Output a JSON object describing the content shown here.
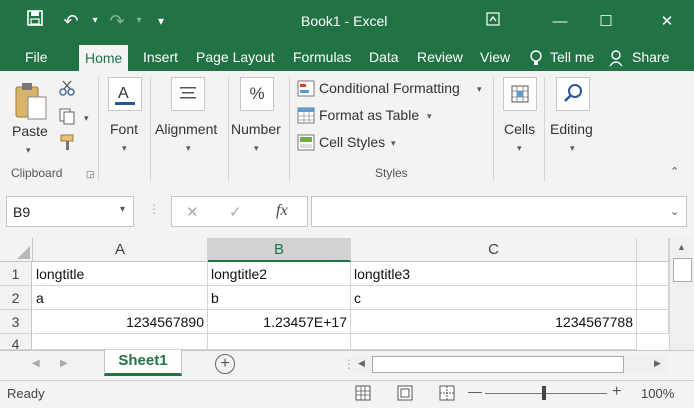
{
  "window": {
    "title": "Book1  -  Excel",
    "minimize": "—",
    "maximize": "☐",
    "close": "✕",
    "ribbon_display": "⬆"
  },
  "qat": {
    "save": "💾",
    "undo": "↶",
    "redo": "↷",
    "customize": "▾"
  },
  "tabs": [
    "File",
    "Home",
    "Insert",
    "Page Layout",
    "Formulas",
    "Data",
    "Review",
    "View"
  ],
  "tell_me": "Tell me",
  "share": "Share",
  "ribbon": {
    "clipboard": {
      "paste": "Paste",
      "group": "Clipboard"
    },
    "font": {
      "label": "Font"
    },
    "alignment": {
      "label": "Alignment"
    },
    "number": {
      "label": "Number",
      "icon": "%"
    },
    "styles": {
      "conditional": "Conditional Formatting",
      "format_table": "Format as Table",
      "cell_styles": "Cell Styles",
      "group": "Styles"
    },
    "cells": {
      "label": "Cells"
    },
    "editing": {
      "label": "Editing"
    }
  },
  "formula_bar": {
    "name_box": "B9",
    "cancel": "✕",
    "enter": "✓",
    "fx": "fx",
    "value": ""
  },
  "columns": [
    "A",
    "B",
    "C"
  ],
  "rows": [
    {
      "num": "1",
      "cells": [
        "longtitle",
        "longtitle2",
        "longtitle3"
      ]
    },
    {
      "num": "2",
      "cells": [
        "a",
        "b",
        "c"
      ]
    },
    {
      "num": "3",
      "cells": [
        "1234567890",
        "1.23457E+17",
        "1234567788"
      ]
    },
    {
      "num": "4",
      "cells": [
        "",
        "",
        ""
      ]
    }
  ],
  "sheet_tab": "Sheet1",
  "add_sheet": "+",
  "status": {
    "ready": "Ready",
    "zoom": "100%",
    "zoom_out": "—",
    "zoom_in": "+"
  },
  "colors": {
    "brand": "#217346",
    "ribbon": "#f3f3f3",
    "grid": "#d4d4d4"
  }
}
